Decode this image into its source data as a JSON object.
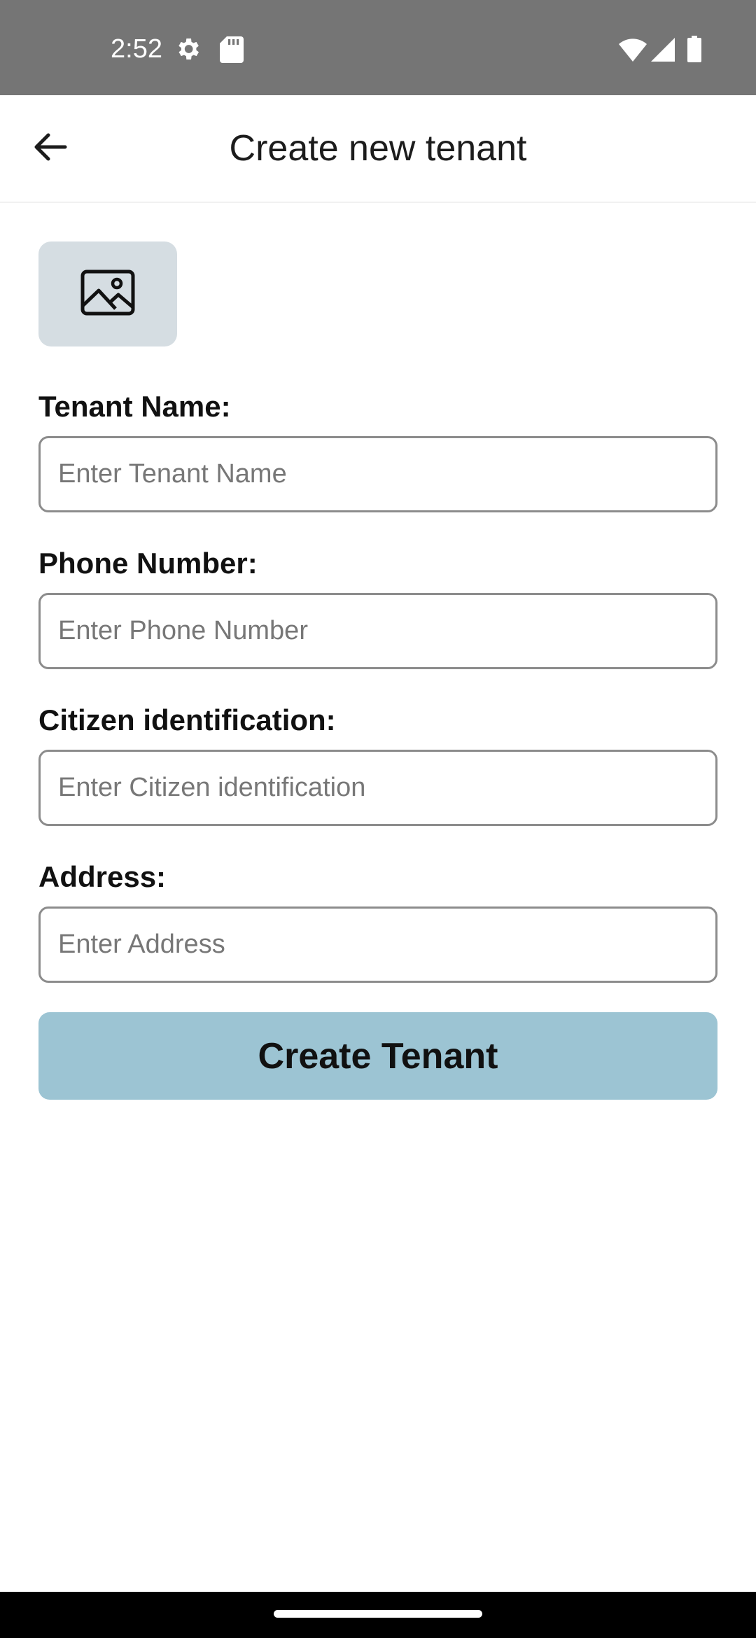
{
  "status_bar": {
    "time": "2:52",
    "icons": [
      "settings-icon",
      "sd-card-icon",
      "wifi-icon",
      "signal-icon",
      "battery-icon"
    ]
  },
  "app_bar": {
    "title": "Create new tenant",
    "back_icon": "arrow-back-icon"
  },
  "image_picker": {
    "icon": "image-icon",
    "background": "#d5dde2"
  },
  "form": {
    "fields": [
      {
        "label": "Tenant Name:",
        "placeholder": "Enter Tenant Name",
        "value": ""
      },
      {
        "label": "Phone Number:",
        "placeholder": "Enter Phone Number",
        "value": ""
      },
      {
        "label": "Citizen identification:",
        "placeholder": "Enter Citizen identification",
        "value": ""
      },
      {
        "label": "Address:",
        "placeholder": "Enter Address",
        "value": ""
      }
    ],
    "submit_label": "Create Tenant",
    "submit_color": "#9cc4d3"
  },
  "colors": {
    "status_bar": "#757575",
    "nav_bar": "#000000"
  }
}
